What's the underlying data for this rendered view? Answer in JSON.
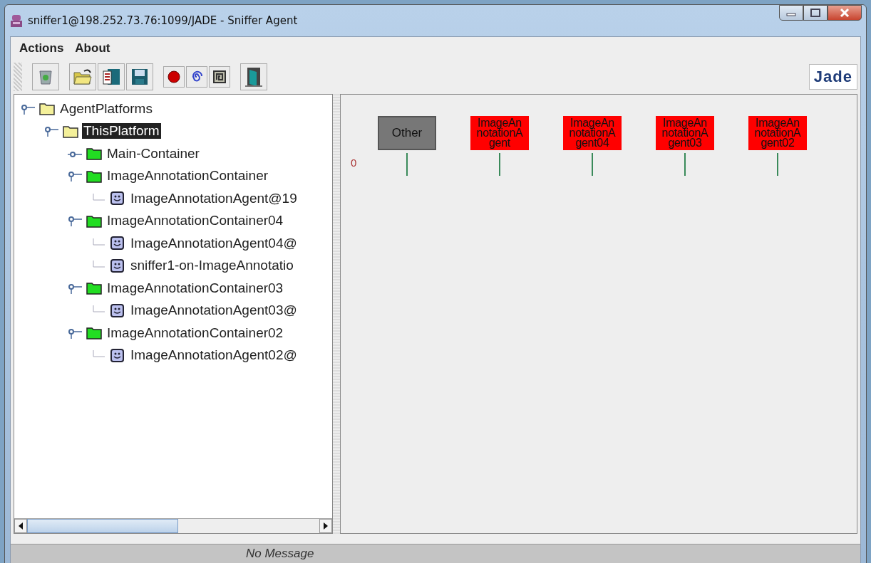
{
  "window": {
    "title": "sniffer1@198.252.73.76:1099/JADE - Sniffer Agent"
  },
  "menu": [
    "Actions",
    "About"
  ],
  "toolbar": {
    "groups": [
      {
        "buttons": [
          {
            "kind": "trash"
          }
        ]
      },
      {
        "buttons": [
          {
            "kind": "open"
          },
          {
            "kind": "report"
          },
          {
            "kind": "save"
          }
        ]
      },
      {
        "buttons": [
          {
            "kind": "record"
          },
          {
            "kind": "spiral"
          },
          {
            "kind": "square"
          }
        ]
      },
      {
        "buttons": [
          {
            "kind": "exit"
          }
        ]
      }
    ],
    "logo": "Jade"
  },
  "tree": [
    {
      "label": "AgentPlatforms",
      "kind": "folder",
      "expanded": true,
      "selected": false,
      "children": [
        {
          "label": "ThisPlatform",
          "kind": "folder",
          "expanded": true,
          "selected": true,
          "children": [
            {
              "label": "Main-Container",
              "kind": "container",
              "expanded": false,
              "selected": false
            },
            {
              "label": "ImageAnnotationContainer",
              "kind": "container",
              "expanded": true,
              "selected": false,
              "children": [
                {
                  "label": "ImageAnnotationAgent@19",
                  "kind": "agent",
                  "selected": false
                }
              ]
            },
            {
              "label": "ImageAnnotationContainer04",
              "kind": "container",
              "expanded": true,
              "selected": false,
              "children": [
                {
                  "label": "ImageAnnotationAgent04@",
                  "kind": "agent",
                  "selected": false
                },
                {
                  "label": "sniffer1-on-ImageAnnotatio",
                  "kind": "agent",
                  "selected": false
                }
              ]
            },
            {
              "label": "ImageAnnotationContainer03",
              "kind": "container",
              "expanded": true,
              "selected": false,
              "children": [
                {
                  "label": "ImageAnnotationAgent03@",
                  "kind": "agent",
                  "selected": false
                }
              ]
            },
            {
              "label": "ImageAnnotationContainer02",
              "kind": "container",
              "expanded": true,
              "selected": false,
              "children": [
                {
                  "label": "ImageAnnotationAgent02@",
                  "kind": "agent",
                  "selected": false
                }
              ]
            }
          ]
        }
      ]
    }
  ],
  "canvas": {
    "time_label": "0",
    "agents": [
      {
        "name": "Other",
        "kind": "other"
      },
      {
        "name": "ImageAnnotationAgent",
        "kind": "sniffed"
      },
      {
        "name": "ImageAnnotationAgent04",
        "kind": "sniffed"
      },
      {
        "name": "ImageAnnotationAgent03",
        "kind": "sniffed"
      },
      {
        "name": "ImageAnnotationAgent02",
        "kind": "sniffed"
      }
    ]
  },
  "status_bar": "No Message"
}
